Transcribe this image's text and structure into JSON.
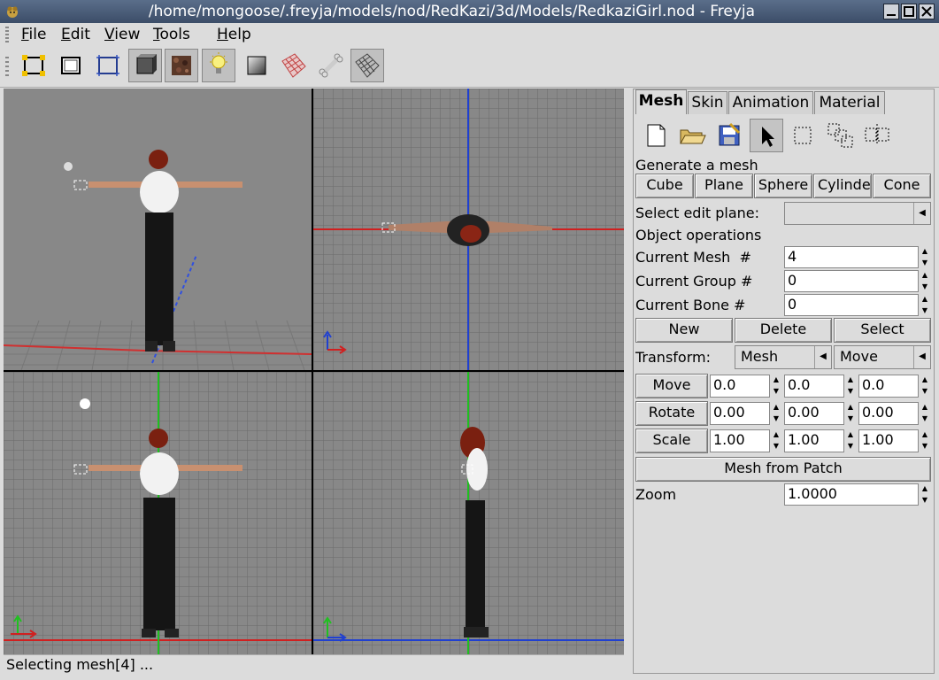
{
  "window": {
    "title": "/home/mongoose/.freyja/models/nod/RedKazi/3d/Models/RedkaziGirl.nod - Freyja"
  },
  "menu": {
    "file": "File",
    "edit": "Edit",
    "view": "View",
    "tools": "Tools",
    "help": "Help"
  },
  "toolbar": {
    "icons": [
      "vertex-mode-icon",
      "face-mode-icon",
      "mesh-mode-icon",
      "solid-render-icon",
      "texture-render-icon",
      "lighting-icon",
      "gradient-icon",
      "material-icon",
      "bone-icon",
      "grid-icon"
    ]
  },
  "panel": {
    "tabs": [
      "Mesh",
      "Skin",
      "Animation",
      "Material"
    ],
    "generate_label": "Generate a mesh",
    "generate_buttons": [
      "Cube",
      "Plane",
      "Sphere",
      "Cylinder",
      "Cone"
    ],
    "edit_plane_label": "Select edit plane:",
    "edit_plane_value": "",
    "object_ops_label": "Object operations",
    "current_mesh_label": "Current Mesh  #",
    "current_mesh_value": "4",
    "current_group_label": "Current Group #",
    "current_group_value": "0",
    "current_bone_label": "Current Bone #",
    "current_bone_value": "0",
    "new": "New",
    "delete": "Delete",
    "select": "Select",
    "transform_label": "Transform:",
    "transform_target": "Mesh",
    "transform_action": "Move",
    "move": "Move",
    "rotate": "Rotate",
    "scale": "Scale",
    "move_values": [
      "0.0",
      "0.0",
      "0.0"
    ],
    "rotate_values": [
      "0.00",
      "0.00",
      "0.00"
    ],
    "scale_values": [
      "1.00",
      "1.00",
      "1.00"
    ],
    "mesh_from_patch": "Mesh from Patch",
    "zoom_label": "Zoom",
    "zoom_value": "1.0000"
  },
  "status": {
    "text": "Selecting mesh[4] ..."
  }
}
